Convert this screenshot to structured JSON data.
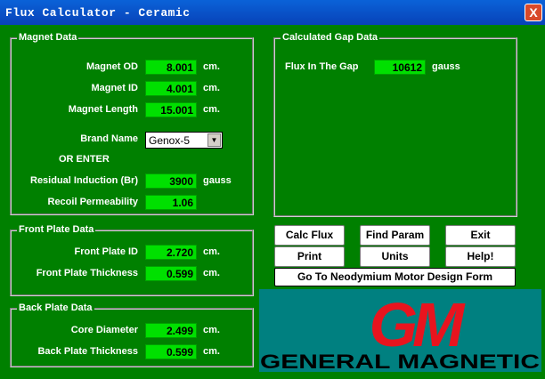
{
  "window": {
    "title": "Flux Calculator - Ceramic",
    "close_glyph": "X"
  },
  "magnet_data": {
    "title": "Magnet Data",
    "od": {
      "label": "Magnet OD",
      "value": "8.001",
      "unit": "cm."
    },
    "id": {
      "label": "Magnet ID",
      "value": "4.001",
      "unit": "cm."
    },
    "length": {
      "label": "Magnet Length",
      "value": "15.001",
      "unit": "cm."
    },
    "brand": {
      "label": "Brand Name",
      "value": "Genox-5"
    },
    "or_enter": "OR ENTER",
    "br": {
      "label": "Residual Induction (Br)",
      "value": "3900",
      "unit": "gauss"
    },
    "recoil": {
      "label": "Recoil Permeability",
      "value": "1.06"
    }
  },
  "front_plate": {
    "title": "Front Plate Data",
    "id": {
      "label": "Front Plate ID",
      "value": "2.720",
      "unit": "cm."
    },
    "thickness": {
      "label": "Front Plate Thickness",
      "value": "0.599",
      "unit": "cm."
    }
  },
  "back_plate": {
    "title": "Back Plate Data",
    "core": {
      "label": "Core Diameter",
      "value": "2.499",
      "unit": "cm."
    },
    "thickness": {
      "label": "Back Plate Thickness",
      "value": "0.599",
      "unit": "cm."
    }
  },
  "gap_data": {
    "title": "Calculated Gap Data",
    "flux": {
      "label": "Flux In The Gap",
      "value": "10612",
      "unit": "gauss"
    }
  },
  "buttons": {
    "calc_flux": "Calc Flux",
    "find_param": "Find Param",
    "exit": "Exit",
    "print": "Print",
    "units": "Units",
    "help": "Help!",
    "neodymium": "Go To Neodymium Motor Design Form"
  },
  "logo": {
    "text": "GENERAL MAGNETIC",
    "mark": "GM",
    "mark_color": "#e8141e"
  }
}
